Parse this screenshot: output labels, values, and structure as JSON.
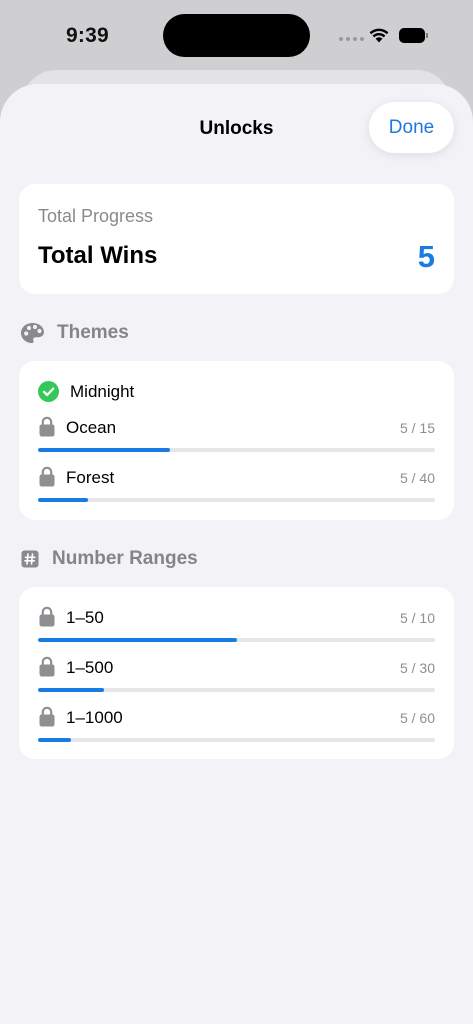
{
  "status": {
    "time": "9:39"
  },
  "nav": {
    "title": "Unlocks",
    "done_label": "Done"
  },
  "summary": {
    "label": "Total Progress",
    "title": "Total Wins",
    "value": "5"
  },
  "themes": {
    "header": "Themes",
    "items": [
      {
        "name": "Midnight",
        "unlocked": true
      },
      {
        "name": "Ocean",
        "count": "5 / 15",
        "progress": 0.3333
      },
      {
        "name": "Forest",
        "count": "5 / 40",
        "progress": 0.125
      }
    ]
  },
  "ranges": {
    "header": "Number Ranges",
    "items": [
      {
        "name": "1–50",
        "count": "5 / 10",
        "progress": 0.5
      },
      {
        "name": "1–500",
        "count": "5 / 30",
        "progress": 0.1667
      },
      {
        "name": "1–1000",
        "count": "5 / 60",
        "progress": 0.0833
      }
    ]
  },
  "colors": {
    "accent": "#1a7be3",
    "success": "#34c759",
    "muted": "#8e8e93",
    "track": "#e5e5ea"
  },
  "icons": {
    "theme": "palette-icon",
    "range": "number-sign-icon",
    "locked": "lock-icon",
    "unlocked": "checkmark-circle-icon"
  }
}
